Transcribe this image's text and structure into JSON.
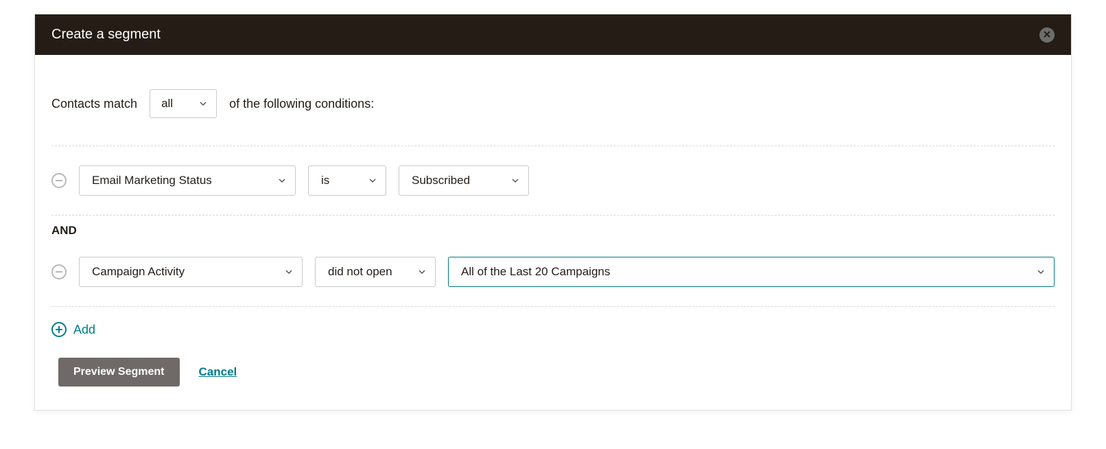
{
  "header": {
    "title": "Create a segment"
  },
  "match": {
    "prefix": "Contacts match",
    "selector": "all",
    "suffix": "of the following conditions:"
  },
  "conditions": [
    {
      "field": "Email Marketing Status",
      "operator": "is",
      "value": "Subscribed"
    },
    {
      "join": "AND",
      "field": "Campaign Activity",
      "operator": "did not open",
      "value": "All of the Last 20 Campaigns"
    }
  ],
  "add_label": "Add",
  "actions": {
    "preview": "Preview Segment",
    "cancel": "Cancel"
  },
  "colors": {
    "accent": "#007c89",
    "header_bg": "#241c15",
    "button_bg": "#6f6a67"
  }
}
